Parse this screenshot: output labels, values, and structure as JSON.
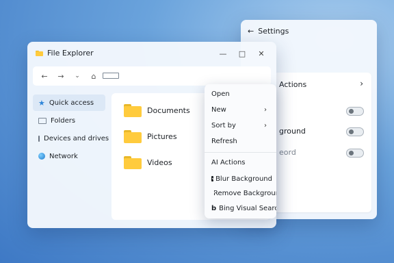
{
  "settings": {
    "back_icon": "back-arrow-icon",
    "title": "Settings",
    "section_label": "Actions",
    "rows": [
      {
        "label": ""
      },
      {
        "label": "ground"
      },
      {
        "label": "eord"
      }
    ]
  },
  "explorer": {
    "title": "File Explorer",
    "window_controls": [
      "minimize",
      "maximize",
      "close"
    ],
    "sidebar": [
      {
        "label": "Quick access",
        "icon": "star-icon",
        "active": true
      },
      {
        "label": "Folders",
        "icon": "folder-icon"
      },
      {
        "label": "Devices and drives",
        "icon": "drive-icon"
      },
      {
        "label": "Network",
        "icon": "network-globe-icon"
      }
    ],
    "files": [
      {
        "name": "Documents"
      },
      {
        "name": "Pictures"
      },
      {
        "name": "Videos"
      }
    ]
  },
  "context_menu": {
    "items": [
      "Open",
      "New",
      "Sort by",
      "Refresh"
    ],
    "ai_header": "AI Actions",
    "ai_items": [
      "Blur Background",
      "Remove Background",
      "Bing Visual Search"
    ]
  },
  "colors": {
    "accent": "#2f86d9",
    "folder": "#ffcb3d",
    "selected_bg": "#dce8f6"
  }
}
